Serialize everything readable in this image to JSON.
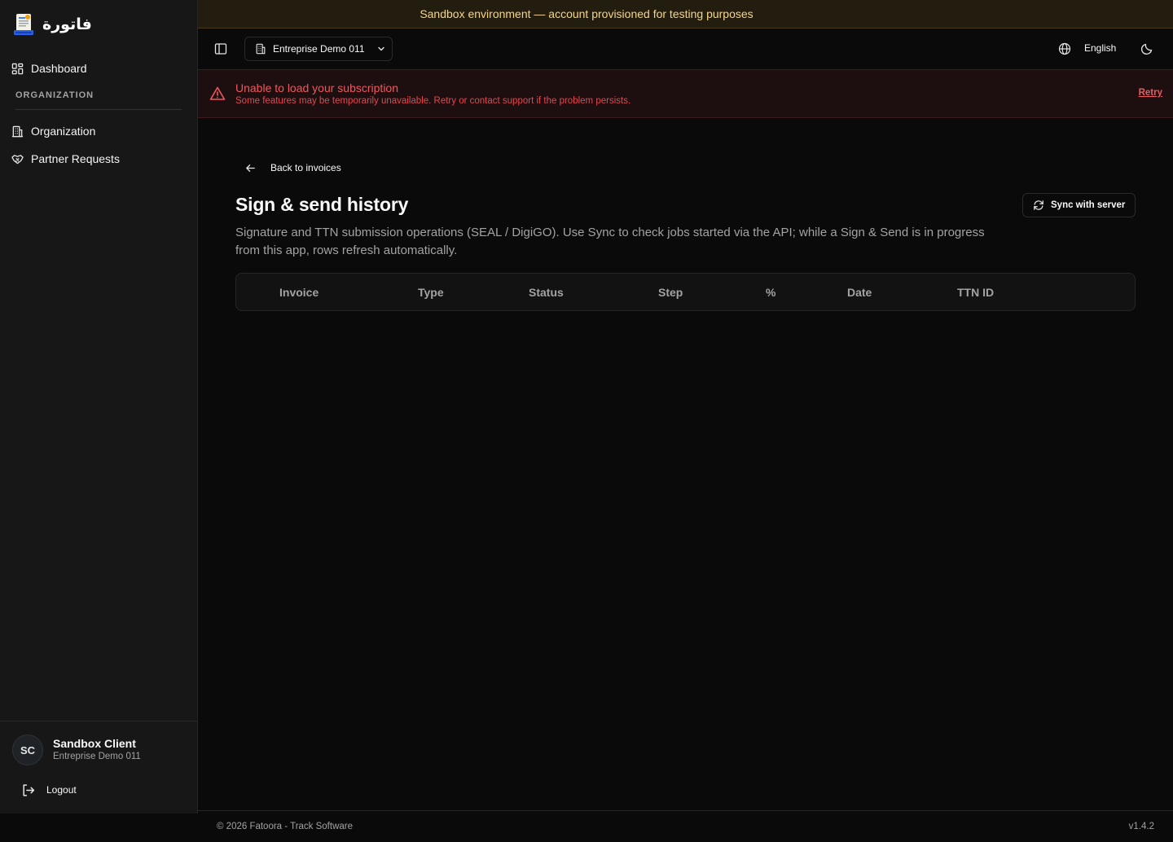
{
  "sandbox_banner": "Sandbox environment — account provisioned for testing purposes",
  "brand": {
    "name": "فاتورة"
  },
  "sidebar": {
    "items": [
      {
        "label": "Dashboard",
        "icon": "dashboard-icon"
      },
      {
        "label": "Organization",
        "icon": "building-icon"
      },
      {
        "label": "Partner Requests",
        "icon": "handshake-icon"
      }
    ],
    "section_label": "ORGANIZATION"
  },
  "user": {
    "initials": "SC",
    "name": "Sandbox Client",
    "org": "Entreprise Demo 011",
    "logout_label": "Logout"
  },
  "header": {
    "org_selector": "Entreprise Demo 011",
    "language": "English"
  },
  "alert": {
    "title": "Unable to load your subscription",
    "description": "Some features may be temporarily unavailable. Retry or contact support if the problem persists.",
    "action": "Retry"
  },
  "page": {
    "back_label": "Back to invoices",
    "title": "Sign & send history",
    "description": "Signature and TTN submission operations (SEAL / DigiGO). Use Sync to check jobs started via the API; while a Sign & Send is in progress from this app, rows refresh automatically.",
    "sync_label": "Sync with server"
  },
  "table": {
    "columns": [
      "Invoice",
      "Type",
      "Status",
      "Step",
      "%",
      "Date",
      "TTN ID"
    ],
    "rows": []
  },
  "footer": {
    "copyright": "© 2026 Fatoora - Track Software",
    "version": "v1.4.2"
  },
  "colors": {
    "background": "#0a0a0a",
    "sidebar": "#171717",
    "banner_text": "#f5d58a",
    "alert_red": "#f0575f"
  }
}
